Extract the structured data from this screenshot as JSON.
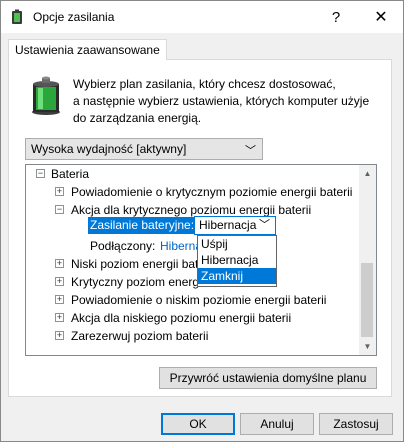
{
  "window": {
    "title": "Opcje zasilania",
    "help_label": "?",
    "close_label": "✕"
  },
  "tab": {
    "label": "Ustawienia zaawansowane"
  },
  "intro": {
    "line1": "Wybierz plan zasilania, który chcesz dostosować,",
    "line2": "a następnie wybierz ustawienia, których komputer użyje",
    "line3": "do zarządzania energią."
  },
  "plan_select": {
    "value": "Wysoka wydajność [aktywny]"
  },
  "tree": {
    "items": [
      {
        "label": "Bateria",
        "expander": "−"
      },
      {
        "label": "Powiadomienie o krytycznym poziomie energii baterii",
        "expander": "+"
      },
      {
        "label": "Akcja dla krytycznego poziomu energii baterii",
        "expander": "−"
      },
      {
        "label": "Zasilanie bateryjne:"
      },
      {
        "label": "Podłączony:",
        "value": "Hibernacja"
      },
      {
        "label": "Niski poziom energii baterii",
        "expander": "+"
      },
      {
        "label": "Krytyczny poziom energii baterii",
        "expander": "+"
      },
      {
        "label": "Powiadomienie o niskim poziomie energii baterii",
        "expander": "+"
      },
      {
        "label": "Akcja dla niskiego poziomu energii baterii",
        "expander": "+"
      },
      {
        "label": "Zarezerwuj poziom baterii",
        "expander": "+"
      }
    ],
    "battery_combo_value": "Hibernacja",
    "dropdown_options": [
      "Uśpij",
      "Hibernacja",
      "Zamknij"
    ],
    "dropdown_selected": "Zamknij"
  },
  "buttons": {
    "restore": "Przywróć ustawienia domyślne planu",
    "ok": "OK",
    "cancel": "Anuluj",
    "apply": "Zastosuj"
  },
  "colors": {
    "selection": "#0078d7",
    "battery_green": "#2aa63a"
  }
}
